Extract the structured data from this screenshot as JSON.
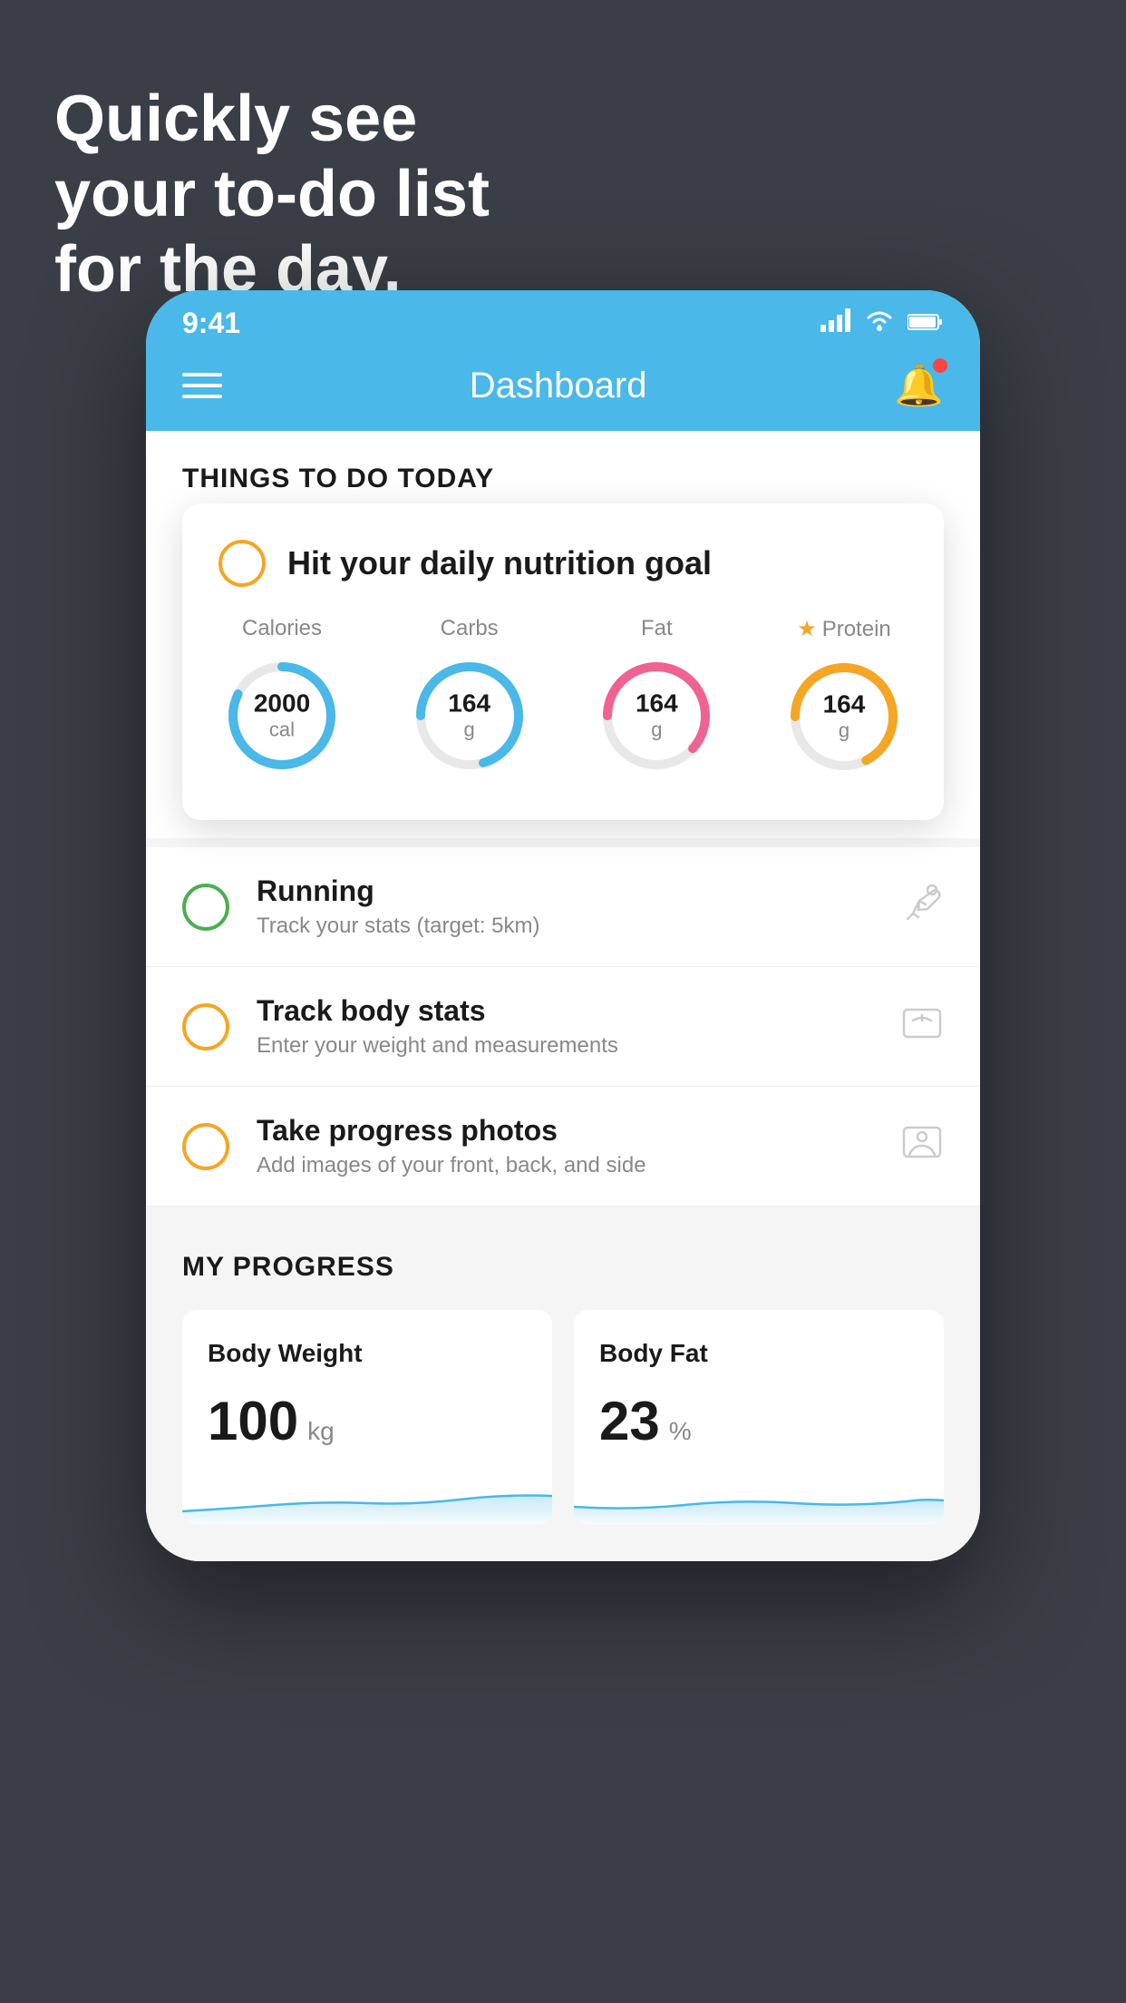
{
  "background_color": "#3a3f47",
  "headline": {
    "line1": "Quickly see",
    "line2": "your to-do list",
    "line3": "for the day."
  },
  "status_bar": {
    "time": "9:41",
    "signal": "▌▌▌▌",
    "wifi": "wifi",
    "battery": "battery"
  },
  "nav": {
    "title": "Dashboard"
  },
  "things_section": {
    "title": "THINGS TO DO TODAY"
  },
  "featured_card": {
    "title": "Hit your daily nutrition goal",
    "nutrition": [
      {
        "label": "Calories",
        "value": "2000",
        "unit": "cal",
        "ring_color": "blue"
      },
      {
        "label": "Carbs",
        "value": "164",
        "unit": "g",
        "ring_color": "blue"
      },
      {
        "label": "Fat",
        "value": "164",
        "unit": "g",
        "ring_color": "pink"
      },
      {
        "label": "Protein",
        "value": "164",
        "unit": "g",
        "ring_color": "yellow",
        "starred": true
      }
    ]
  },
  "todo_items": [
    {
      "title": "Running",
      "subtitle": "Track your stats (target: 5km)",
      "circle_color": "green",
      "icon": "shoe"
    },
    {
      "title": "Track body stats",
      "subtitle": "Enter your weight and measurements",
      "circle_color": "yellow",
      "icon": "scale"
    },
    {
      "title": "Take progress photos",
      "subtitle": "Add images of your front, back, and side",
      "circle_color": "yellow",
      "icon": "person"
    }
  ],
  "progress_section": {
    "title": "MY PROGRESS",
    "cards": [
      {
        "title": "Body Weight",
        "value": "100",
        "unit": "kg"
      },
      {
        "title": "Body Fat",
        "value": "23",
        "unit": "%"
      }
    ]
  }
}
